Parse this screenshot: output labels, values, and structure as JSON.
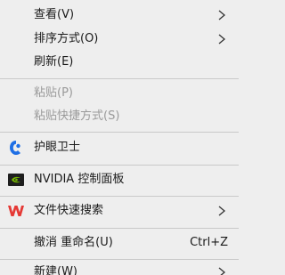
{
  "menu": {
    "items": [
      {
        "label": "查看(V)",
        "submenu": true
      },
      {
        "label": "排序方式(O)",
        "submenu": true
      },
      {
        "label": "刷新(E)"
      },
      {
        "label": "粘贴(P)",
        "disabled": true
      },
      {
        "label": "粘贴快捷方式(S)",
        "disabled": true
      },
      {
        "label": "护眼卫士",
        "icon": "eye-guard-icon"
      },
      {
        "label": "NVIDIA 控制面板",
        "icon": "nvidia-icon"
      },
      {
        "label": "文件快速搜索",
        "icon": "wps-icon",
        "submenu": true
      },
      {
        "label": "撤消 重命名(U)",
        "shortcut": "Ctrl+Z"
      },
      {
        "label": "新建(W)",
        "submenu": true
      }
    ]
  },
  "colors": {
    "background": "#eeeeee",
    "separator": "#c9c9c9",
    "disabled_text": "#9a9a9a",
    "eye_guard_blue": "#1f6fe5",
    "nvidia_green": "#76b900",
    "wps_red": "#e53935"
  }
}
